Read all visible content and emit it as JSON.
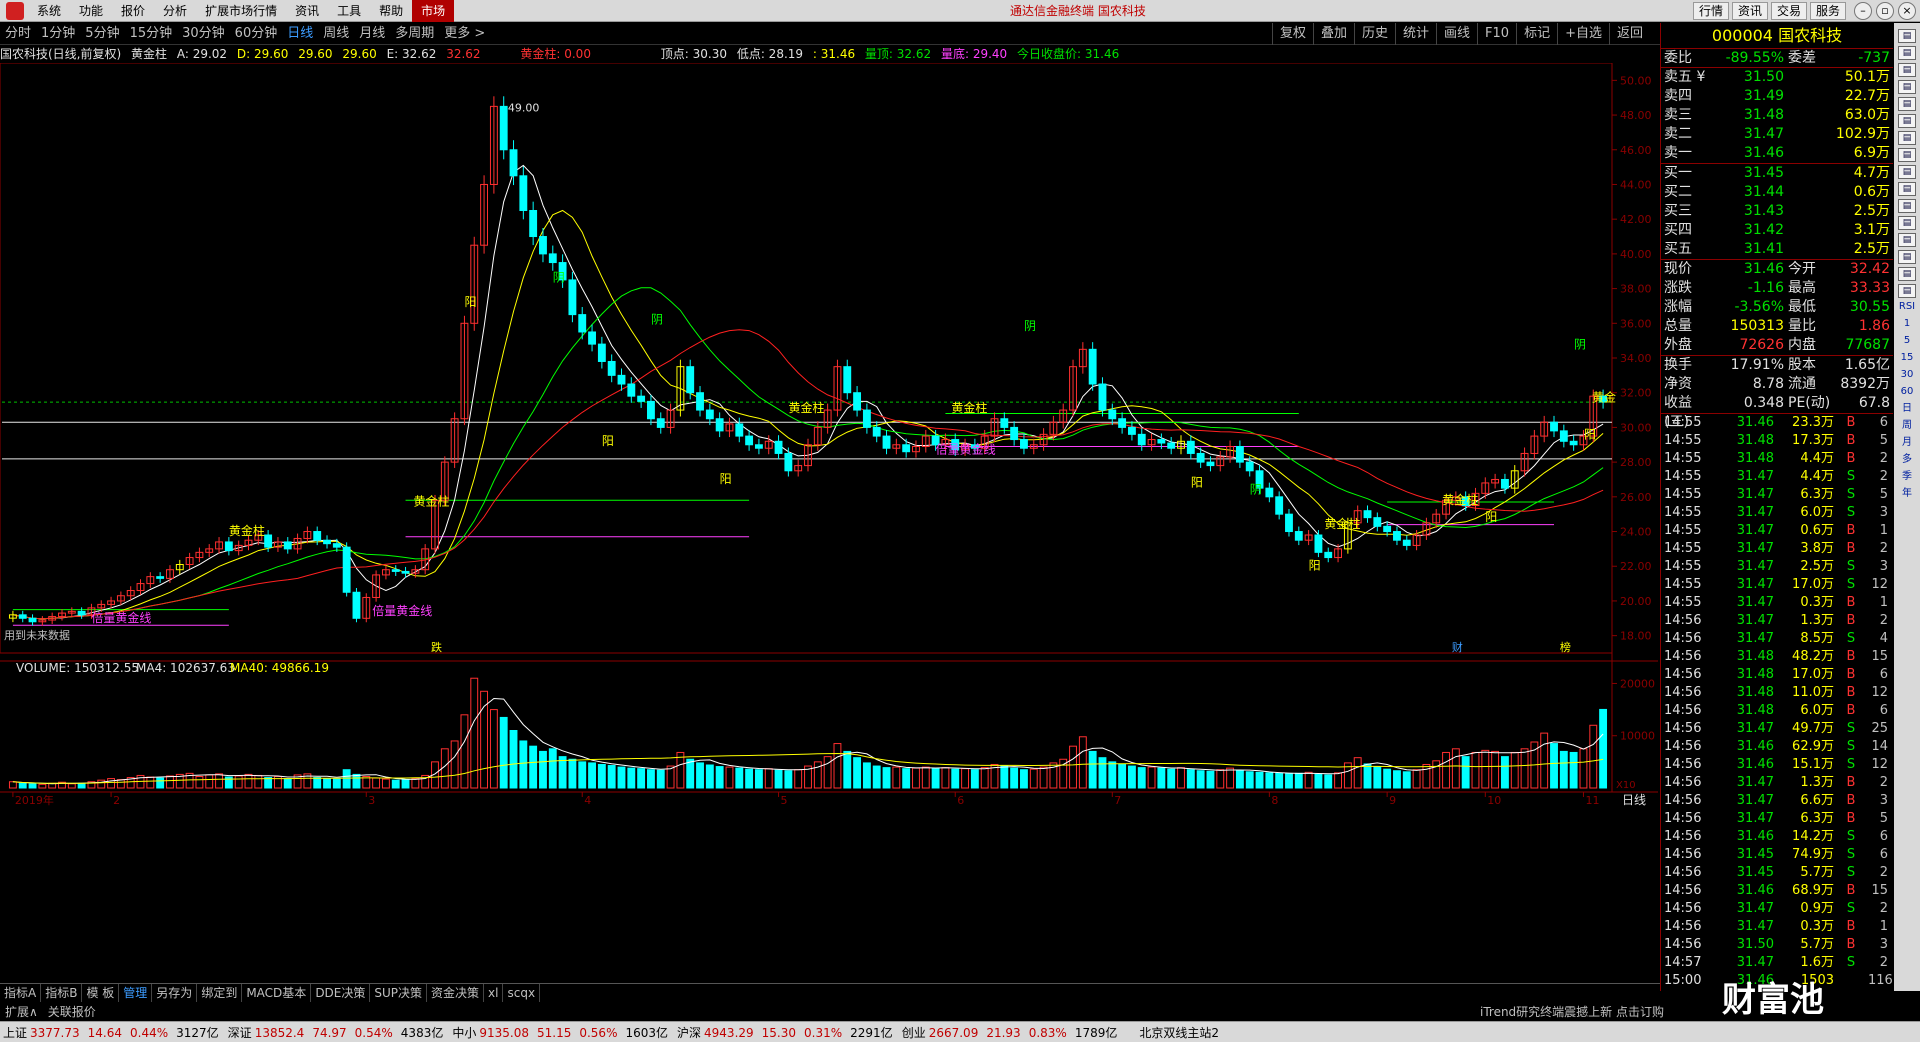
{
  "menubar": {
    "items": [
      "系统",
      "功能",
      "报价",
      "分析",
      "扩展市场行情",
      "资讯",
      "工具",
      "帮助"
    ],
    "active_item": "市场",
    "center_title": "通达信金融终端  国农科技",
    "right_buttons": [
      "行情",
      "资讯",
      "交易",
      "服务"
    ]
  },
  "periods": [
    "分时",
    "1分钟",
    "5分钟",
    "15分钟",
    "30分钟",
    "60分钟",
    "日线",
    "周线",
    "月线",
    "多周期",
    "更多 >"
  ],
  "active_period": "日线",
  "tools": [
    "复权",
    "叠加",
    "历史",
    "统计",
    "画线",
    "F10",
    "标记",
    "+自选",
    "返回"
  ],
  "infoline": {
    "name": "国农科技(日线,前复权)",
    "indicator": "黄金柱",
    "A": "A: 29.02",
    "D": "D: 29.60",
    "v1": "29.60",
    "v2": "29.60",
    "E": "E: 32.62",
    "v3": "32.62",
    "hjz": "黄金柱: 0.00",
    "top": "顶点: 30.30",
    "low": "低点: 28.19",
    "v4": ": 31.46",
    "lt": "量顶: 32.62",
    "ld": "量底: 29.40",
    "close": "今日收盘价: 31.46"
  },
  "chart_data": {
    "type": "candlestick",
    "title": "国农科技(日线,前复权)",
    "price_axis_ticks": [
      50,
      48,
      46,
      44,
      42,
      40,
      38,
      36,
      34,
      32,
      30,
      28,
      26,
      24,
      22,
      20,
      18
    ],
    "price_axis_ticks_labels": [
      "50.00",
      "48.00",
      "46.00",
      "44.00",
      "42.00",
      "40.00",
      "38.00",
      "36.00",
      "34.00",
      "32.00",
      "30.00",
      "28.00",
      "26.00",
      "24.00",
      "22.00",
      "20.00",
      "18.00"
    ],
    "ylim": [
      17,
      51
    ],
    "x_month_labels": [
      "2019年",
      "2",
      "3",
      "4",
      "5",
      "6",
      "7",
      "8",
      "9",
      "10",
      "11"
    ],
    "peak_label": "49.00",
    "close_markers": [
      {
        "label": "阴",
        "price": 34.9
      },
      {
        "label": "阳",
        "price": 29.6
      }
    ],
    "annotations": [
      "黄金柱",
      "倍量黄金线",
      "阴",
      "阳",
      "黄金"
    ],
    "volume_indicator": "VOLUME: 150312.55",
    "volume_ma4": "MA4: 102637.63",
    "volume_ma40": "MA40: 49866.19",
    "volume_axis_ticks": [
      20000,
      10000
    ],
    "volume_axis_labels": [
      "20000",
      "10000"
    ],
    "volume_unit": "X10",
    "bottom_markers": [
      "跌",
      "财",
      "榜"
    ],
    "future_data_label": "用到未来数据",
    "x_axis_right_label": "日线",
    "series_close": [
      19.2,
      19.0,
      18.8,
      18.9,
      19.1,
      19.3,
      19.4,
      19.2,
      19.6,
      19.8,
      20.0,
      20.3,
      20.6,
      21.0,
      21.4,
      21.3,
      21.8,
      22.1,
      22.5,
      22.8,
      23.0,
      23.4,
      22.9,
      23.2,
      23.5,
      23.8,
      23.1,
      23.4,
      23.0,
      23.6,
      24.0,
      23.5,
      23.3,
      23.1,
      20.5,
      19.0,
      20.2,
      21.5,
      21.8,
      21.7,
      21.6,
      21.8,
      23.0,
      25.8,
      28.0,
      30.5,
      36.0,
      40.5,
      44.0,
      48.5,
      46.0,
      44.5,
      42.5,
      41.0,
      40.0,
      39.5,
      38.5,
      36.5,
      35.5,
      34.8,
      33.8,
      33.0,
      32.5,
      31.8,
      31.5,
      30.5,
      30.0,
      31.0,
      33.5,
      32.0,
      31.0,
      30.5,
      29.8,
      30.2,
      29.5,
      29.0,
      28.8,
      29.2,
      28.5,
      27.5,
      27.8,
      29.0,
      30.0,
      31.0,
      33.5,
      32.0,
      31.0,
      30.0,
      29.5,
      28.8,
      29.0,
      28.6,
      28.9,
      29.5,
      29.0,
      29.3,
      28.7,
      29.0,
      28.8,
      29.5,
      30.5,
      30.0,
      29.3,
      28.8,
      29.0,
      29.6,
      30.3,
      31.0,
      33.5,
      34.5,
      32.5,
      31.0,
      30.5,
      30.0,
      29.6,
      29.0,
      29.3,
      29.1,
      28.8,
      29.2,
      28.5,
      28.0,
      27.8,
      28.3,
      28.9,
      28.0,
      27.5,
      26.5,
      26.0,
      25.0,
      24.0,
      23.5,
      23.8,
      22.8,
      22.5,
      23.0,
      24.5,
      25.2,
      24.8,
      24.3,
      24.0,
      23.5,
      23.2,
      23.8,
      24.5,
      25.0,
      25.8,
      26.0,
      25.5,
      26.2,
      26.8,
      27.0,
      26.5,
      27.5,
      28.5,
      29.5,
      30.3,
      29.8,
      29.2,
      29.0,
      29.5,
      31.8,
      31.46
    ],
    "series_volume": [
      1200,
      900,
      800,
      700,
      900,
      1100,
      800,
      900,
      1200,
      1500,
      1800,
      1600,
      2000,
      2400,
      2100,
      1900,
      2300,
      2600,
      2800,
      2200,
      2500,
      2700,
      2100,
      2300,
      2600,
      2400,
      2000,
      2200,
      1800,
      2500,
      2700,
      2000,
      1800,
      1700,
      3500,
      2600,
      2200,
      1900,
      1700,
      1500,
      1600,
      1800,
      2400,
      5000,
      7500,
      9000,
      14000,
      21000,
      18500,
      15000,
      13500,
      11000,
      9000,
      8000,
      7000,
      7500,
      6000,
      5500,
      5000,
      4800,
      4500,
      4300,
      4000,
      3800,
      3700,
      3500,
      3400,
      4200,
      6800,
      5500,
      4800,
      4400,
      4100,
      4000,
      3800,
      3600,
      3500,
      3700,
      3400,
      3300,
      3500,
      4200,
      5000,
      6000,
      8500,
      7000,
      5800,
      4800,
      4200,
      3900,
      4000,
      3700,
      3800,
      4000,
      3800,
      3900,
      3600,
      3700,
      3500,
      3900,
      4500,
      4200,
      3800,
      3500,
      3600,
      4000,
      4800,
      5500,
      8000,
      9800,
      7000,
      5800,
      5000,
      4500,
      4200,
      3900,
      4000,
      3800,
      3600,
      3900,
      3500,
      3300,
      3200,
      3500,
      3800,
      3300,
      3100,
      3000,
      2900,
      2800,
      2700,
      2800,
      3000,
      2600,
      2500,
      2900,
      4800,
      5800,
      4600,
      4000,
      3600,
      3300,
      3100,
      3500,
      4500,
      5200,
      6800,
      7500,
      6000,
      6800,
      7200,
      7000,
      6000,
      6800,
      7500,
      8800,
      10500,
      8500,
      7000,
      6800,
      7500,
      12000,
      15031
    ]
  },
  "quote": {
    "code_name": "000004 国农科技",
    "wb_label": "委比",
    "wb_value": "-89.55%",
    "wc_label": "委差",
    "wc_value": "-737",
    "asks": [
      {
        "label": "卖五 ¥",
        "price": "31.50",
        "vol": "50.1万"
      },
      {
        "label": "卖四",
        "price": "31.49",
        "vol": "22.7万"
      },
      {
        "label": "卖三",
        "price": "31.48",
        "vol": "63.0万"
      },
      {
        "label": "卖二",
        "price": "31.47",
        "vol": "102.9万"
      },
      {
        "label": "卖一",
        "price": "31.46",
        "vol": "6.9万"
      }
    ],
    "bids": [
      {
        "label": "买一",
        "price": "31.45",
        "vol": "4.7万"
      },
      {
        "label": "买二",
        "price": "31.44",
        "vol": "0.6万"
      },
      {
        "label": "买三",
        "price": "31.43",
        "vol": "2.5万"
      },
      {
        "label": "买四",
        "price": "31.42",
        "vol": "3.1万"
      },
      {
        "label": "买五",
        "price": "31.41",
        "vol": "2.5万"
      }
    ],
    "stats": [
      {
        "l1": "现价",
        "v1": "31.46",
        "c1": "green",
        "l2": "今开",
        "v2": "32.42",
        "c2": "red"
      },
      {
        "l1": "涨跌",
        "v1": "-1.16",
        "c1": "green",
        "l2": "最高",
        "v2": "33.33",
        "c2": "red"
      },
      {
        "l1": "涨幅",
        "v1": "-3.56%",
        "c1": "green",
        "l2": "最低",
        "v2": "30.55",
        "c2": "green"
      },
      {
        "l1": "总量",
        "v1": "150313",
        "c1": "yellow",
        "l2": "量比",
        "v2": "1.86",
        "c2": "red"
      },
      {
        "l1": "外盘",
        "v1": "72626",
        "c1": "red",
        "l2": "内盘",
        "v2": "77687",
        "c2": "green"
      }
    ],
    "stats2": [
      {
        "l1": "换手",
        "v1": "17.91%",
        "l2": "股本",
        "v2": "1.65亿"
      },
      {
        "l1": "净资",
        "v1": "8.78",
        "l2": "流通",
        "v2": "8392万"
      },
      {
        "l1": "收益(三)",
        "v1": "0.348",
        "l2": "PE(动)",
        "v2": "67.8"
      }
    ],
    "ticks": [
      {
        "t": "14:55",
        "p": "31.46",
        "pc": "green",
        "v": "23.3万",
        "d": "B",
        "n": "6"
      },
      {
        "t": "14:55",
        "p": "31.48",
        "pc": "green",
        "v": "17.3万",
        "d": "B",
        "n": "5"
      },
      {
        "t": "14:55",
        "p": "31.48",
        "pc": "green",
        "v": "4.4万",
        "d": "B",
        "n": "2"
      },
      {
        "t": "14:55",
        "p": "31.47",
        "pc": "green",
        "v": "4.4万",
        "d": "S",
        "n": "2"
      },
      {
        "t": "14:55",
        "p": "31.47",
        "pc": "green",
        "v": "6.3万",
        "d": "S",
        "n": "5"
      },
      {
        "t": "14:55",
        "p": "31.47",
        "pc": "green",
        "v": "6.0万",
        "d": "S",
        "n": "3"
      },
      {
        "t": "14:55",
        "p": "31.47",
        "pc": "green",
        "v": "0.6万",
        "d": "B",
        "n": "1"
      },
      {
        "t": "14:55",
        "p": "31.47",
        "pc": "green",
        "v": "3.8万",
        "d": "B",
        "n": "2"
      },
      {
        "t": "14:55",
        "p": "31.47",
        "pc": "green",
        "v": "2.5万",
        "d": "S",
        "n": "3"
      },
      {
        "t": "14:55",
        "p": "31.47",
        "pc": "green",
        "v": "17.0万",
        "d": "S",
        "n": "12"
      },
      {
        "t": "14:55",
        "p": "31.47",
        "pc": "green",
        "v": "0.3万",
        "d": "B",
        "n": "1"
      },
      {
        "t": "14:56",
        "p": "31.47",
        "pc": "green",
        "v": "1.3万",
        "d": "B",
        "n": "2"
      },
      {
        "t": "14:56",
        "p": "31.47",
        "pc": "green",
        "v": "8.5万",
        "d": "S",
        "n": "4"
      },
      {
        "t": "14:56",
        "p": "31.48",
        "pc": "green",
        "v": "48.2万",
        "d": "B",
        "n": "15"
      },
      {
        "t": "14:56",
        "p": "31.48",
        "pc": "green",
        "v": "17.0万",
        "d": "B",
        "n": "6"
      },
      {
        "t": "14:56",
        "p": "31.48",
        "pc": "green",
        "v": "11.0万",
        "d": "B",
        "n": "12"
      },
      {
        "t": "14:56",
        "p": "31.48",
        "pc": "green",
        "v": "6.0万",
        "d": "B",
        "n": "6"
      },
      {
        "t": "14:56",
        "p": "31.47",
        "pc": "green",
        "v": "49.7万",
        "d": "S",
        "n": "25"
      },
      {
        "t": "14:56",
        "p": "31.46",
        "pc": "green",
        "v": "62.9万",
        "d": "S",
        "n": "14"
      },
      {
        "t": "14:56",
        "p": "31.46",
        "pc": "green",
        "v": "15.1万",
        "d": "S",
        "n": "12"
      },
      {
        "t": "14:56",
        "p": "31.47",
        "pc": "green",
        "v": "1.3万",
        "d": "B",
        "n": "2"
      },
      {
        "t": "14:56",
        "p": "31.47",
        "pc": "green",
        "v": "6.6万",
        "d": "B",
        "n": "3"
      },
      {
        "t": "14:56",
        "p": "31.47",
        "pc": "green",
        "v": "6.3万",
        "d": "B",
        "n": "5"
      },
      {
        "t": "14:56",
        "p": "31.46",
        "pc": "green",
        "v": "14.2万",
        "d": "S",
        "n": "6"
      },
      {
        "t": "14:56",
        "p": "31.45",
        "pc": "green",
        "v": "74.9万",
        "d": "S",
        "n": "6"
      },
      {
        "t": "14:56",
        "p": "31.45",
        "pc": "green",
        "v": "5.7万",
        "d": "S",
        "n": "2"
      },
      {
        "t": "14:56",
        "p": "31.46",
        "pc": "green",
        "v": "68.9万",
        "d": "B",
        "n": "15"
      },
      {
        "t": "14:56",
        "p": "31.47",
        "pc": "green",
        "v": "0.9万",
        "d": "S",
        "n": "2"
      },
      {
        "t": "14:56",
        "p": "31.47",
        "pc": "green",
        "v": "0.3万",
        "d": "B",
        "n": "1"
      },
      {
        "t": "14:56",
        "p": "31.50",
        "pc": "green",
        "v": "5.7万",
        "d": "B",
        "n": "3"
      },
      {
        "t": "14:57",
        "p": "31.47",
        "pc": "green",
        "v": "1.6万",
        "d": "S",
        "n": "2"
      },
      {
        "t": "15:00",
        "p": "31.46",
        "pc": "green",
        "v": "1503",
        "d": "",
        "n": "116"
      }
    ],
    "bottom_tabs": [
      "笔",
      "价"
    ]
  },
  "icon_strip": [
    "icon-1",
    "icon-2",
    "icon-3",
    "icon-4",
    "icon-5",
    "icon-6",
    "icon-7",
    "icon-8",
    "icon-9",
    "icon-10",
    "icon-11",
    "icon-12",
    "icon-13",
    "icon-14",
    "icon-15",
    "icon-16"
  ],
  "icon_strip_text": [
    "RSI",
    "1",
    "5",
    "15",
    "30",
    "60",
    "日",
    "周",
    "月",
    "多",
    "季",
    "年"
  ],
  "bottom_tabs": [
    "指标A",
    "指标B",
    "模 板",
    "管理",
    "另存为",
    "绑定到",
    "MACD基本",
    "DDE决策",
    "SUP决策",
    "资金决策",
    "xl",
    "scqx"
  ],
  "active_bottom_tab": "管理",
  "ext_bar": [
    "扩展∧",
    "关联报价"
  ],
  "news": "iTrend研究终端震撼上新 点击订购",
  "status": {
    "indices": [
      {
        "name": "上证",
        "value": "3377.73",
        "chg": "14.64",
        "pct": "0.44%",
        "amt": "3127亿"
      },
      {
        "name": "深证",
        "value": "13852.4",
        "chg": "74.97",
        "pct": "0.54%",
        "amt": "4383亿"
      },
      {
        "name": "中小",
        "value": "9135.08",
        "chg": "51.15",
        "pct": "0.56%",
        "amt": "1603亿"
      },
      {
        "name": "沪深",
        "value": "4943.29",
        "chg": "15.30",
        "pct": "0.31%",
        "amt": "2291亿"
      },
      {
        "name": "创业",
        "value": "2667.09",
        "chg": "21.93",
        "pct": "0.83%",
        "amt": "1789亿"
      }
    ],
    "server": "北京双线主站2"
  },
  "watermark": "财富池"
}
